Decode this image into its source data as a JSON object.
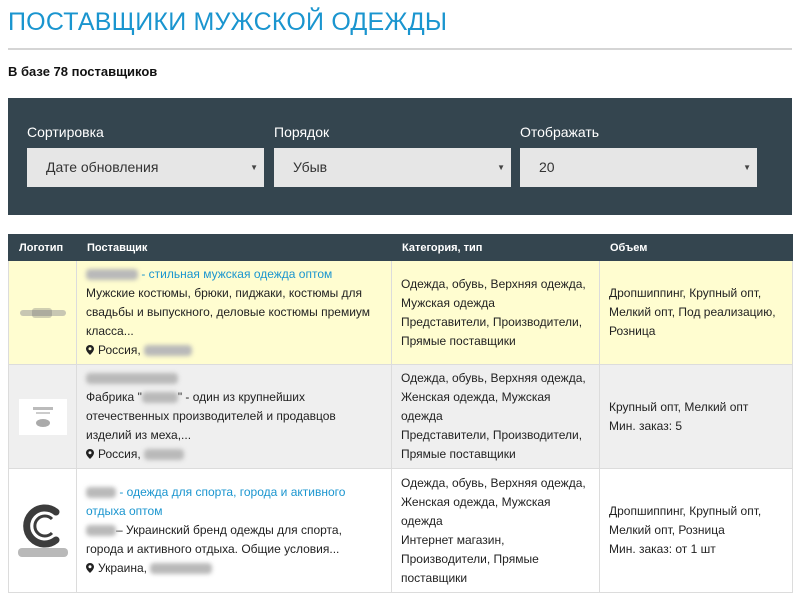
{
  "page": {
    "title": "ПОСТАВЩИКИ МУЖСКОЙ ОДЕЖДЫ",
    "count_text": "В базе 78 поставщиков"
  },
  "filters": {
    "sort": {
      "label": "Сортировка",
      "value": "Дате обновления"
    },
    "order": {
      "label": "Порядок",
      "value": "Убыв"
    },
    "display": {
      "label": "Отображать",
      "value": "20"
    },
    "caret_icon": "▼"
  },
  "table": {
    "headers": {
      "logo": "Логотип",
      "supplier": "Поставщик",
      "category": "Категория, тип",
      "volume": "Объем"
    },
    "rows": [
      {
        "title_suffix": " - стильная мужская одежда оптом",
        "description": "Мужские костюмы, брюки, пиджаки, костюмы для свадьбы и выпускного, деловые костюмы премиум класса...",
        "location_prefix": "Россия, ",
        "categories": "Одежда, обувь, Верхняя одежда, Мужская одежда",
        "types": "Представители, Производители, Прямые поставщики",
        "volume": "Дропшиппинг, Крупный опт, Мелкий опт, Под реализацию, Розница",
        "min_order": ""
      },
      {
        "title_suffix": "",
        "description_prefix": "Фабрика \"",
        "description": "\" - один из крупнейших отечественных производителей и продавцов изделий из меха,...",
        "location_prefix": "Россия, ",
        "categories": "Одежда, обувь, Верхняя одежда, Женская одежда, Мужская одежда",
        "types": "Представители, Производители, Прямые поставщики",
        "volume": "Крупный опт, Мелкий опт",
        "min_order": "Мин. заказ: 5"
      },
      {
        "title_suffix": " - одежда для спорта, города и активного отдыха оптом",
        "description": "– Украинский бренд одежды для спорта, города и активного отдыха. Общие условия...",
        "location_prefix": "Украина, ",
        "categories": "Одежда, обувь, Верхняя одежда, Женская одежда, Мужская одежда",
        "types": "Интернет магазин, Производители, Прямые поставщики",
        "volume": "Дропшиппинг, Крупный опт, Мелкий опт, Розница",
        "min_order": "Мин. заказ: от 1 шт"
      }
    ]
  },
  "colors": {
    "accent": "#1a95cf",
    "panel": "#34454f",
    "highlight_row": "#fffdd0"
  },
  "icons": {
    "location": "map-pin-icon",
    "dropdown": "caret-down-icon"
  }
}
